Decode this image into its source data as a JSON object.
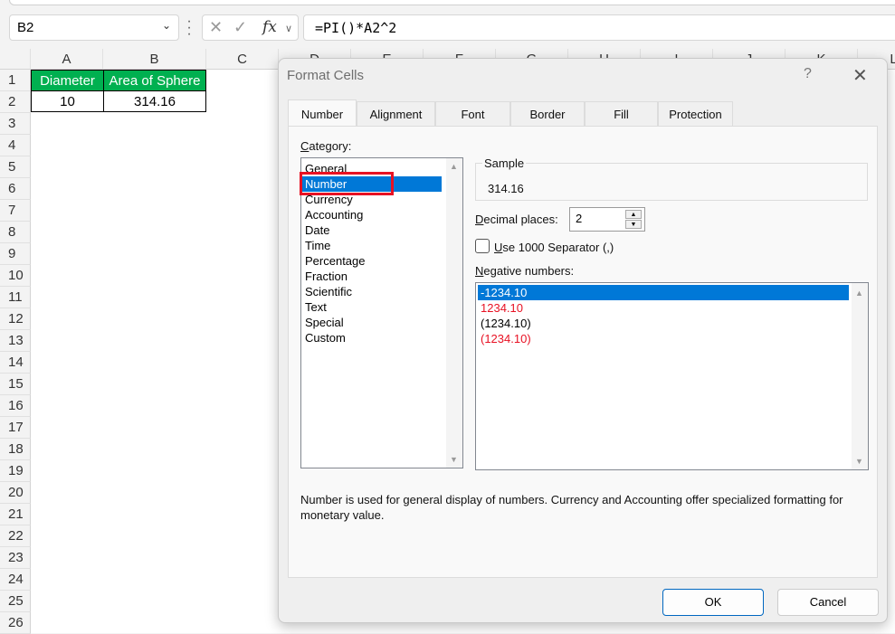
{
  "formula_bar": {
    "name_box": "B2",
    "formula": "=PI()*A2^2",
    "fx_label": "fx"
  },
  "sheet": {
    "columns": [
      "A",
      "B",
      "C",
      "D",
      "E",
      "F",
      "G",
      "H",
      "I",
      "J",
      "K",
      "L"
    ],
    "rows": [
      "1",
      "2",
      "3",
      "4",
      "5",
      "6",
      "7",
      "8",
      "9",
      "10",
      "11",
      "12",
      "13",
      "14",
      "15",
      "16",
      "17",
      "18",
      "19",
      "20",
      "21",
      "22",
      "23",
      "24",
      "25",
      "26"
    ],
    "cells": {
      "A1": "Diameter",
      "B1": "Area of Sphere",
      "A2": "10",
      "B2": "314.16"
    },
    "header_fill": "#00b050"
  },
  "dialog": {
    "title": "Format Cells",
    "help": "?",
    "tabs": [
      "Number",
      "Alignment",
      "Font",
      "Border",
      "Fill",
      "Protection"
    ],
    "active_tab": "Number",
    "category_label": "Category:",
    "categories": [
      "General",
      "Number",
      "Currency",
      "Accounting",
      "Date",
      "Time",
      "Percentage",
      "Fraction",
      "Scientific",
      "Text",
      "Special",
      "Custom"
    ],
    "selected_category": "Number",
    "sample_label": "Sample",
    "sample_value": "314.16",
    "decimal_places_label": "Decimal places:",
    "decimal_places_value": "2",
    "separator_label": "Use 1000 Separator (,)",
    "separator_checked": false,
    "negative_label": "Negative numbers:",
    "negative_options": [
      {
        "text": "-1234.10",
        "color": "#000000"
      },
      {
        "text": "1234.10",
        "color": "#e81123"
      },
      {
        "text": "(1234.10)",
        "color": "#000000"
      },
      {
        "text": "(1234.10)",
        "color": "#e81123"
      }
    ],
    "selected_negative": "-1234.10",
    "description": "Number is used for general display of numbers.  Currency and Accounting offer specialized formatting for monetary value.",
    "ok_label": "OK",
    "cancel_label": "Cancel"
  }
}
